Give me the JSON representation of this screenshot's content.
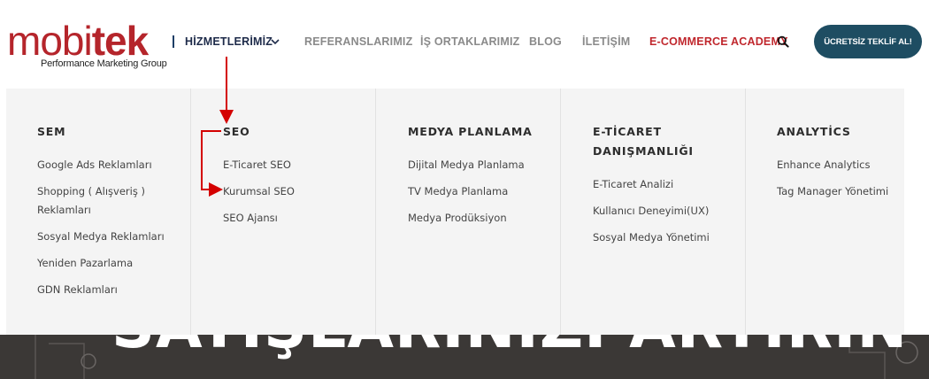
{
  "header": {
    "logo": {
      "main_a": "mobi",
      "main_b": "tek",
      "sub": "Performance Marketing Group"
    },
    "nav": {
      "services": "HİZMETLERİMİZ",
      "references": "REFERANSLARIMIZ",
      "partners": "İŞ ORTAKLARIMIZ",
      "blog": "BLOG",
      "contact": "İLETİŞİM",
      "academy": "E-COMMERCE ACADEMY"
    },
    "cta": "ÜCRETSİZ TEKLİF AL!"
  },
  "hero": {
    "title": "SATIŞLARINIZI ARTIRIN"
  },
  "mega_menu": {
    "columns": [
      {
        "title": "SEM",
        "items": [
          "Google Ads Reklamları",
          "Shopping ( Alışveriş )",
          "Reklamları",
          "Sosyal Medya Reklamları",
          "Yeniden Pazarlama",
          "GDN Reklamları"
        ]
      },
      {
        "title": "SEO",
        "items": [
          "E-Ticaret SEO",
          "Kurumsal SEO",
          "SEO Ajansı"
        ]
      },
      {
        "title": "MEDYA PLANLAMA",
        "items": [
          "Dijital Medya Planlama",
          "TV Medya Planlama",
          "Medya Prodüksiyon"
        ]
      },
      {
        "title_line1": "E-TİCARET",
        "title_line2": "DANIŞMANLIĞI",
        "items": [
          "E-Ticaret Analizi",
          "Kullanıcı Deneyimi(UX)",
          "Sosyal Medya Yönetimi"
        ]
      },
      {
        "title": "ANALYTİCS",
        "items": [
          "Enhance Analytics",
          "Tag Manager Yönetimi"
        ]
      }
    ]
  },
  "colors": {
    "brand_red": "#b5252b",
    "nav_dark": "#1e2b4a",
    "nav_gray": "#8a8a8a",
    "academy_red": "#c0272d",
    "cta_bg": "#1e4d62",
    "annotation_red": "#d40000"
  },
  "icons": [
    "chevron-down-icon",
    "search-icon"
  ]
}
